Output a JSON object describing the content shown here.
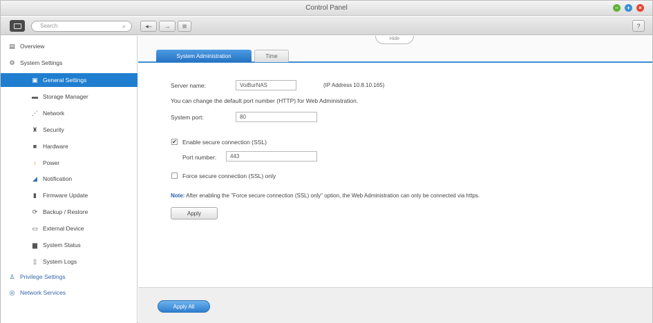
{
  "window": {
    "title": "Control Panel"
  },
  "toolbar": {
    "search_placeholder": "Search",
    "back_icon": "back-arrow-icon",
    "forward_icon": "forward-arrow-icon",
    "help_label": "?"
  },
  "sidebar": {
    "items": [
      {
        "label": "Overview",
        "icon": "overview-icon",
        "level": "top"
      },
      {
        "label": "System Settings",
        "icon": "gear-icon",
        "level": "top"
      },
      {
        "label": "General Settings",
        "icon": "general-settings-icon",
        "level": "sub",
        "selected": true
      },
      {
        "label": "Storage Manager",
        "icon": "storage-icon",
        "level": "sub"
      },
      {
        "label": "Network",
        "icon": "network-icon",
        "level": "sub"
      },
      {
        "label": "Security",
        "icon": "security-icon",
        "level": "sub"
      },
      {
        "label": "Hardware",
        "icon": "hardware-icon",
        "level": "sub"
      },
      {
        "label": "Power",
        "icon": "power-icon",
        "level": "sub"
      },
      {
        "label": "Notification",
        "icon": "notification-icon",
        "level": "sub"
      },
      {
        "label": "Firmware Update",
        "icon": "firmware-icon",
        "level": "sub"
      },
      {
        "label": "Backup / Restore",
        "icon": "backup-icon",
        "level": "sub"
      },
      {
        "label": "External Device",
        "icon": "external-device-icon",
        "level": "sub"
      },
      {
        "label": "System Status",
        "icon": "system-status-icon",
        "level": "sub"
      },
      {
        "label": "System Logs",
        "icon": "system-logs-icon",
        "level": "sub"
      },
      {
        "label": "Privilege Settings",
        "icon": "privilege-icon",
        "level": "top"
      },
      {
        "label": "Network Services",
        "icon": "network-services-icon",
        "level": "top"
      }
    ]
  },
  "content": {
    "hide_tab_label": "Hide",
    "tabs": [
      {
        "label": "System Administration",
        "active": true
      },
      {
        "label": "Time",
        "active": false
      }
    ],
    "server_name_label": "Server name:",
    "server_name_value": "VoiBurNAS",
    "ip_address_text": "(IP Address 10.8.10.165)",
    "port_info_text": "You can change the default port number (HTTP) for Web Administration.",
    "system_port_label": "System port:",
    "system_port_value": "80",
    "ssl_checkbox_label": "Enable secure connection (SSL)",
    "ssl_checked": true,
    "port_number_label": "Port number:",
    "port_number_value": "443",
    "force_ssl_label": "Force secure connection (SSL) only",
    "force_ssl_checked": false,
    "note_prefix": "Note:",
    "note_text": "After enabling the \"Force secure connection (SSL) only\" option, the Web Administration can only be connected via https.",
    "apply_label": "Apply",
    "apply_all_label": "Apply All"
  },
  "colors": {
    "accent": "#1f7ed0",
    "win_min": "#5fb33a",
    "win_max": "#3a8fd6",
    "win_close": "#e0462f"
  }
}
